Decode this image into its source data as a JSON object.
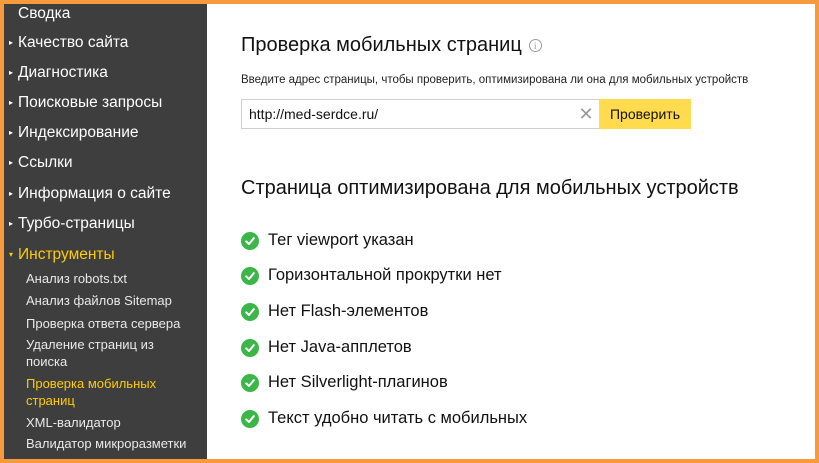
{
  "sidebar": {
    "items": [
      {
        "label": "Сводка"
      },
      {
        "label": "Качество сайта"
      },
      {
        "label": "Диагностика"
      },
      {
        "label": "Поисковые запросы"
      },
      {
        "label": "Индексирование"
      },
      {
        "label": "Ссылки"
      },
      {
        "label": "Информация о сайте"
      },
      {
        "label": "Турбо-страницы"
      },
      {
        "label": "Инструменты"
      }
    ],
    "sub_items": [
      {
        "label": "Анализ robots.txt"
      },
      {
        "label": "Анализ файлов Sitemap"
      },
      {
        "label": "Проверка ответа сервера"
      },
      {
        "label": "Удаление страниц из поиска"
      },
      {
        "label": "Проверка мобильных страниц"
      },
      {
        "label": "XML-валидатор"
      },
      {
        "label": "Валидатор микроразметки"
      }
    ]
  },
  "main": {
    "title": "Проверка мобильных страниц",
    "hint": "Введите адрес страницы, чтобы проверить, оптимизирована ли она для мобильных устройств",
    "url_value": "http://med-serdce.ru/",
    "check_button": "Проверить",
    "result_title": "Страница оптимизирована для мобильных устройств",
    "checks": [
      "Тег viewport указан",
      "Горизонтальной прокрутки нет",
      "Нет Flash-элементов",
      "Нет Java-апплетов",
      "Нет Silverlight-плагинов",
      "Текст удобно читать с мобильных"
    ]
  },
  "colors": {
    "frame": "#f79a3e",
    "sidebar_bg": "#3e3e3e",
    "active": "#ffcc00",
    "button": "#ffdb4d",
    "check": "#3cb649"
  }
}
